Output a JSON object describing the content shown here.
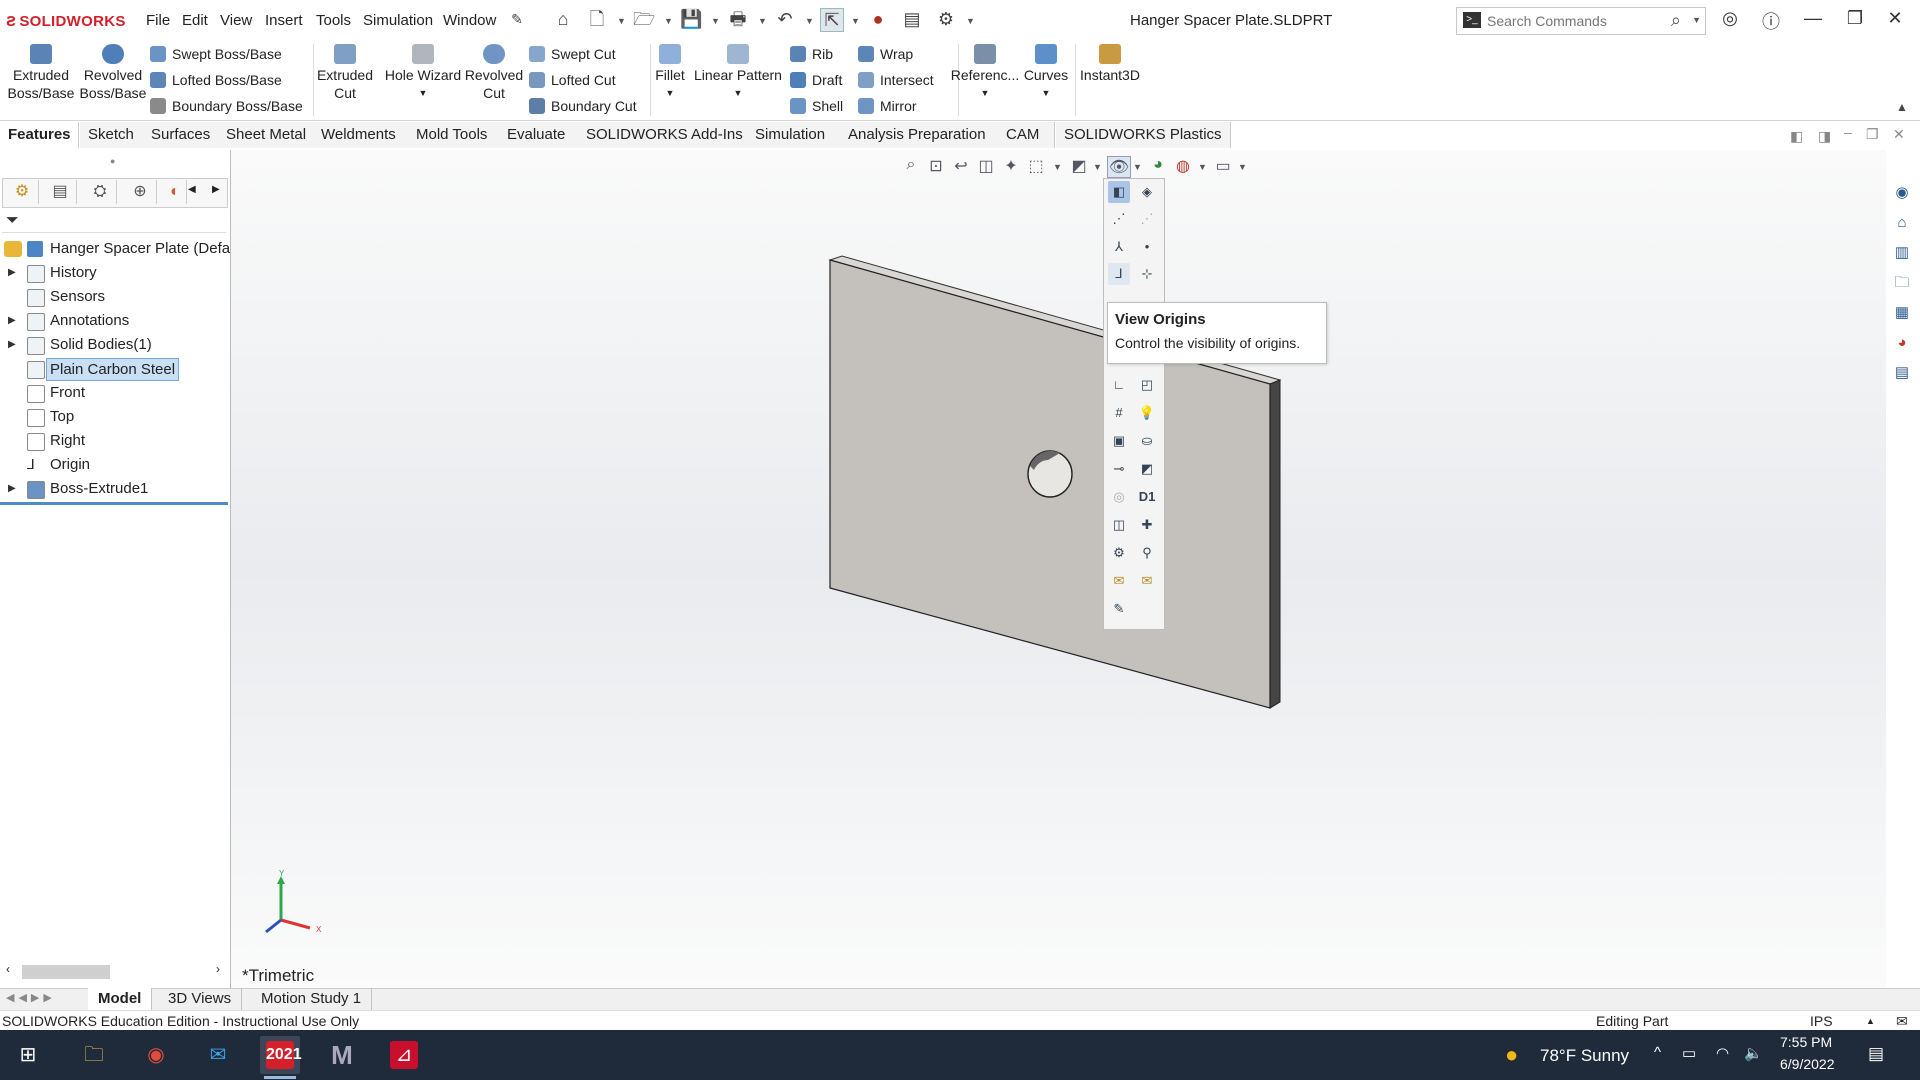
{
  "app": {
    "logo": "SOLIDWORKS",
    "document_title": "Hanger Spacer Plate.SLDPRT"
  },
  "menu": [
    "File",
    "Edit",
    "View",
    "Insert",
    "Tools",
    "Simulation",
    "Window"
  ],
  "search": {
    "placeholder": "Search Commands"
  },
  "ribbon": {
    "big": [
      {
        "label": "Extruded\nBoss/Base"
      },
      {
        "label": "Revolved\nBoss/Base"
      },
      {
        "label": "Extruded\nCut"
      },
      {
        "label": "Hole Wizard"
      },
      {
        "label": "Revolved\nCut"
      },
      {
        "label": "Fillet"
      },
      {
        "label": "Linear Pattern"
      },
      {
        "label": "Referenc..."
      },
      {
        "label": "Curves"
      },
      {
        "label": "Instant3D"
      }
    ],
    "small": [
      "Swept Boss/Base",
      "Lofted Boss/Base",
      "Boundary Boss/Base",
      "Swept Cut",
      "Lofted Cut",
      "Boundary Cut",
      "Rib",
      "Draft",
      "Shell",
      "Wrap",
      "Intersect",
      "Mirror"
    ]
  },
  "tabs": [
    "Features",
    "Sketch",
    "Surfaces",
    "Sheet Metal",
    "Weldments",
    "Mold Tools",
    "Evaluate",
    "SOLIDWORKS Add-Ins",
    "Simulation",
    "Analysis Preparation",
    "CAM",
    "SOLIDWORKS Plastics"
  ],
  "tree": {
    "root": "Hanger Spacer Plate  (Defa",
    "items": [
      "History",
      "Sensors",
      "Annotations",
      "Solid Bodies(1)",
      "Plain Carbon Steel",
      "Front",
      "Top",
      "Right",
      "Origin",
      "Boss-Extrude1"
    ],
    "selected": "Plain Carbon Steel"
  },
  "tooltip": {
    "title": "View Origins",
    "body": "Control the visibility of origins."
  },
  "flyout": {
    "d1": "D1"
  },
  "triad": {
    "y": "Y",
    "x": "X"
  },
  "view_name": "*Trimetric",
  "bottom_tabs": [
    "Model",
    "3D Views",
    "Motion Study 1"
  ],
  "status": {
    "left": "SOLIDWORKS Education Edition - Instructional Use Only",
    "mode": "Editing Part",
    "units": "IPS"
  },
  "taskbar": {
    "weather": "78°F  Sunny",
    "time": "7:55 PM",
    "date": "6/9/2022",
    "sw_badge": "2021"
  }
}
